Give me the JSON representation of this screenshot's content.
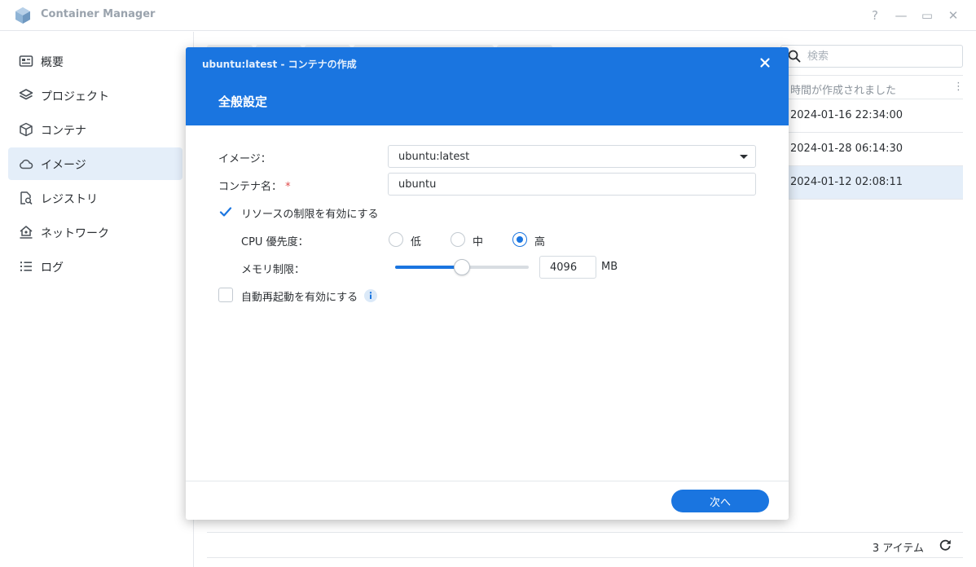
{
  "app": {
    "title": "Container Manager",
    "window_controls": {
      "help": "?",
      "minimize": "—",
      "maximize": "▭",
      "close": "✕"
    }
  },
  "sidebar": {
    "items": [
      {
        "label": "概要",
        "icon": "overview-icon",
        "active": false
      },
      {
        "label": "プロジェクト",
        "icon": "layers-icon",
        "active": false
      },
      {
        "label": "コンテナ",
        "icon": "cube-icon",
        "active": false
      },
      {
        "label": "イメージ",
        "icon": "cloud-icon",
        "active": true
      },
      {
        "label": "レジストリ",
        "icon": "registry-search-icon",
        "active": false
      },
      {
        "label": "ネットワーク",
        "icon": "home-network-icon",
        "active": false
      },
      {
        "label": "ログ",
        "icon": "list-icon",
        "active": false
      }
    ]
  },
  "main": {
    "search": {
      "placeholder": "検索",
      "value": ""
    },
    "column_header": "時間が作成されました",
    "rows": [
      {
        "created": "2024-01-16 22:34:00",
        "selected": false
      },
      {
        "created": "2024-01-28 06:14:30",
        "selected": false
      },
      {
        "created": "2024-01-12 02:08:11",
        "selected": true
      }
    ],
    "item_count": "3 アイテム"
  },
  "modal": {
    "title": "ubuntu:latest - コンテナの作成",
    "section": "全般設定",
    "image_label": "イメージ：",
    "image_value": "ubuntu:latest",
    "container_name_label": "コンテナ名：",
    "container_name_required": "*",
    "container_name_value": "ubuntu",
    "resource_limit_label": "リソースの制限を有効にする",
    "resource_limit_checked": true,
    "cpu_priority_label": "CPU 優先度：",
    "cpu_options": [
      "低",
      "中",
      "高"
    ],
    "cpu_selected": "高",
    "memory_limit_label": "メモリ制限：",
    "memory_value": "4096",
    "memory_unit": "MB",
    "memory_slider_fraction": 0.5,
    "auto_restart_label": "自動再起動を有効にする",
    "auto_restart_checked": false,
    "next_button": "次へ"
  },
  "colors": {
    "accent": "#1a75e0",
    "selected_bg": "#e4eef9",
    "required": "#e04b4b"
  }
}
